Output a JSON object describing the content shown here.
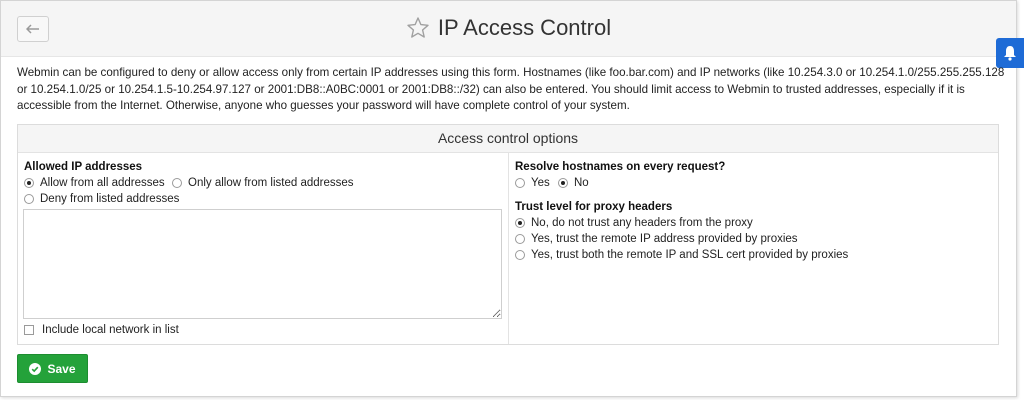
{
  "header": {
    "title": "IP Access Control"
  },
  "intro": {
    "text": "Webmin can be configured to deny or allow access only from certain IP addresses using this form. Hostnames (like foo.bar.com) and IP networks (like 10.254.3.0 or 10.254.1.0/255.255.255.128 or 10.254.1.0/25 or 10.254.1.5-10.254.97.127 or 2001:DB8::A0BC:0001 or 2001:DB8::/32) can also be entered. You should limit access to Webmin to trusted addresses, especially if it is accessible from the Internet. Otherwise, anyone who guesses your password will have complete control of your system."
  },
  "panel": {
    "title": "Access control options",
    "allowed": {
      "label": "Allowed IP addresses",
      "options": [
        {
          "label": "Allow from all addresses",
          "selected": true
        },
        {
          "label": "Only allow from listed addresses",
          "selected": false
        },
        {
          "label": "Deny from listed addresses",
          "selected": false
        }
      ],
      "addresses_value": "",
      "include_local_label": "Include local network in list",
      "include_local_checked": false
    },
    "resolve": {
      "label": "Resolve hostnames on every request?",
      "options": [
        {
          "label": "Yes",
          "selected": false
        },
        {
          "label": "No",
          "selected": true
        }
      ]
    },
    "trust": {
      "label": "Trust level for proxy headers",
      "options": [
        {
          "label": "No, do not trust any headers from the proxy",
          "selected": true
        },
        {
          "label": "Yes, trust the remote IP address provided by proxies",
          "selected": false
        },
        {
          "label": "Yes, trust both the remote IP and SSL cert provided by proxies",
          "selected": false
        }
      ]
    }
  },
  "actions": {
    "save_label": "Save"
  },
  "icons": {
    "back": "back-arrow-icon",
    "favorite": "star-outline-icon",
    "notifications": "bell-icon",
    "save": "check-circle-icon"
  },
  "colors": {
    "save_button": "#24a23a",
    "notification_tab": "#1e6bd6"
  }
}
